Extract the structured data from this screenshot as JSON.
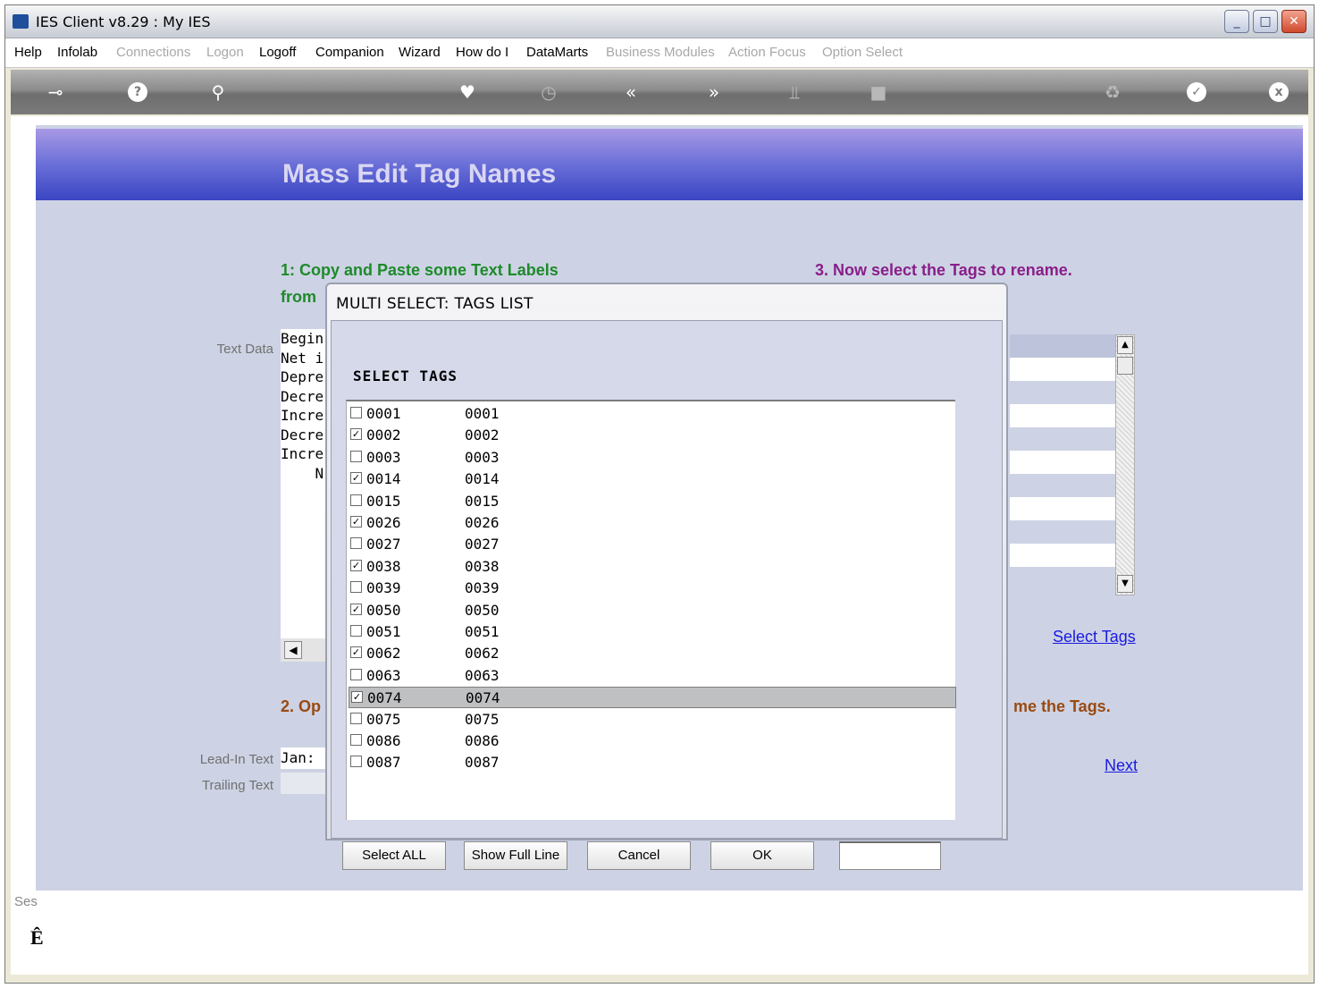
{
  "window": {
    "title": "IES Client v8.29 : My IES"
  },
  "menu": [
    {
      "label": "Help",
      "enabled": true
    },
    {
      "label": "Infolab",
      "enabled": true
    },
    {
      "label": "Connections",
      "enabled": false
    },
    {
      "label": "Logon",
      "enabled": false
    },
    {
      "label": "Logoff",
      "enabled": true
    },
    {
      "label": "Companion",
      "enabled": true
    },
    {
      "label": "Wizard",
      "enabled": true
    },
    {
      "label": "How do I",
      "enabled": true
    },
    {
      "label": "DataMarts",
      "enabled": true
    },
    {
      "label": "Business Modules",
      "enabled": false
    },
    {
      "label": "Action Focus",
      "enabled": false
    },
    {
      "label": "Option Select",
      "enabled": false
    }
  ],
  "toolbar": {
    "icons": [
      "key-icon",
      "help-icon",
      "search-icon",
      "heart-icon",
      "clock-icon",
      "back-icon",
      "forward-icon",
      "tools-icon",
      "stop-icon",
      "recycle-icon",
      "check-icon",
      "close-icon"
    ],
    "glyphs": {
      "key": "⊸",
      "help": "?",
      "search": "⚲",
      "heart": "♥",
      "clock": "◷",
      "back": "«",
      "forward": "»",
      "tools": "⫫",
      "stop": "■",
      "recycle": "♻",
      "check": "✓",
      "close": "x"
    }
  },
  "page": {
    "heading": "Mass Edit Tag Names",
    "step1": "1: Copy and Paste some Text Labels",
    "step1b": "from",
    "step3": "3. Now select the Tags to rename.",
    "step2": "2. Op",
    "step4": "me the Tags.",
    "text_data_label": "Text Data",
    "text_lines": [
      "Begin",
      "Net i",
      "Depre",
      "Decre",
      "Incre",
      "Decre",
      "Incre",
      "    N"
    ],
    "lead_in_label": "Lead-In Text",
    "lead_in_value": "Jan:",
    "trailing_label": "Trailing Text",
    "select_tags_link": "Select Tags",
    "next_link": "Next",
    "status_partial": "Ses",
    "status_icon": "Ê"
  },
  "dialog": {
    "title": "MULTI SELECT: TAGS LIST",
    "heading": "SELECT TAGS",
    "items": [
      {
        "code": "0001",
        "name": "0001",
        "checked": false
      },
      {
        "code": "0002",
        "name": "0002",
        "checked": true
      },
      {
        "code": "0003",
        "name": "0003",
        "checked": false
      },
      {
        "code": "0014",
        "name": "0014",
        "checked": true
      },
      {
        "code": "0015",
        "name": "0015",
        "checked": false
      },
      {
        "code": "0026",
        "name": "0026",
        "checked": true
      },
      {
        "code": "0027",
        "name": "0027",
        "checked": false
      },
      {
        "code": "0038",
        "name": "0038",
        "checked": true
      },
      {
        "code": "0039",
        "name": "0039",
        "checked": false
      },
      {
        "code": "0050",
        "name": "0050",
        "checked": true
      },
      {
        "code": "0051",
        "name": "0051",
        "checked": false
      },
      {
        "code": "0062",
        "name": "0062",
        "checked": true
      },
      {
        "code": "0063",
        "name": "0063",
        "checked": false
      },
      {
        "code": "0074",
        "name": "0074",
        "checked": true,
        "highlighted": true
      },
      {
        "code": "0075",
        "name": "0075",
        "checked": false
      },
      {
        "code": "0086",
        "name": "0086",
        "checked": false
      },
      {
        "code": "0087",
        "name": "0087",
        "checked": false
      }
    ],
    "buttons": {
      "select_all": "Select ALL",
      "show_full_line": "Show Full Line",
      "cancel": "Cancel",
      "ok": "OK"
    },
    "search_value": ""
  }
}
